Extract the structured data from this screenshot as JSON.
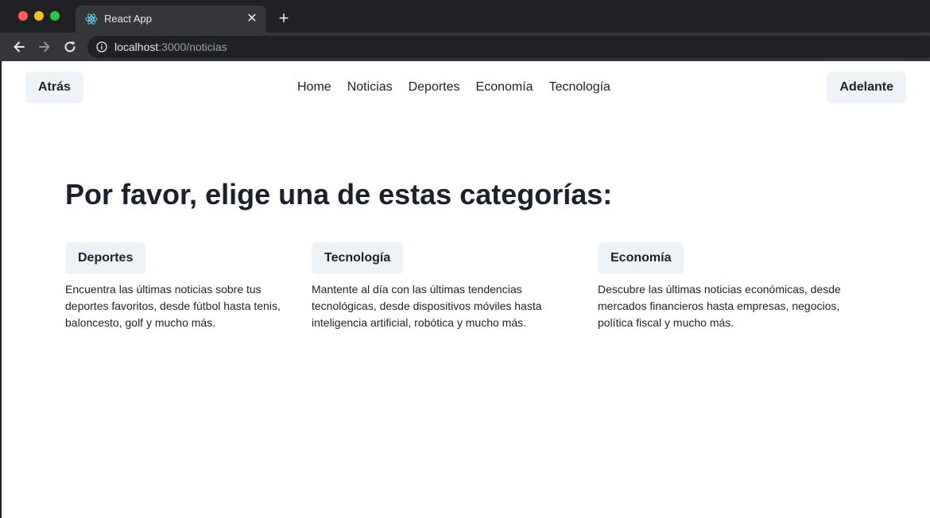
{
  "browser": {
    "tab_title": "React App",
    "url_host": "localhost",
    "url_rest": ":3000/noticias",
    "colors": {
      "chrome_dark": "#202124",
      "chrome_mid": "#35363a",
      "react_blue": "#61dafb"
    }
  },
  "header": {
    "back_label": "Atrás",
    "forward_label": "Adelante",
    "nav": [
      "Home",
      "Noticias",
      "Deportes",
      "Economía",
      "Tecnología"
    ]
  },
  "main": {
    "title": "Por favor, elige una de estas categorías:",
    "categories": [
      {
        "label": "Deportes",
        "description": "Encuentra las últimas noticias sobre tus deportes favoritos, desde fútbol hasta tenis, baloncesto, golf y mucho más."
      },
      {
        "label": "Tecnología",
        "description": "Mantente al día con las últimas tendencias tecnológicas, desde dispositivos móviles hasta inteligencia artificial, robótica y mucho más."
      },
      {
        "label": "Economía",
        "description": "Descubre las últimas noticias económicas, desde mercados financieros hasta empresas, negocios, política fiscal y mucho más."
      }
    ]
  }
}
